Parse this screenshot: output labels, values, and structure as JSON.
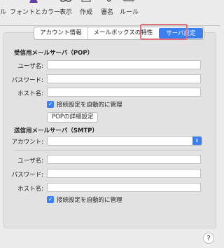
{
  "toolbar": {
    "items": [
      {
        "label": "ル"
      },
      {
        "label": "フォントとカラー"
      },
      {
        "label": "表示"
      },
      {
        "label": "作成"
      },
      {
        "label": "署名"
      },
      {
        "label": "ルール"
      }
    ]
  },
  "tabs": {
    "account_info": "アカウント情報",
    "mailbox_behaviors": "メールボックスの特性",
    "server_settings": "サーバ設定"
  },
  "incoming": {
    "title": "受信用メールサーバ（POP）",
    "username_label": "ユーザ名:",
    "password_label": "パスワード:",
    "host_label": "ホスト名:",
    "auto_manage_label": "接続設定を自動的に管理",
    "pop_details_button": "POPの詳細設定"
  },
  "outgoing": {
    "title": "送信用メールサーバ（SMTP）",
    "account_label": "アカウント:",
    "username_label": "ユーザ名:",
    "password_label": "パスワード:",
    "host_label": "ホスト名:",
    "auto_manage_label": "接続設定を自動的に管理"
  },
  "help": {
    "label": "?"
  }
}
